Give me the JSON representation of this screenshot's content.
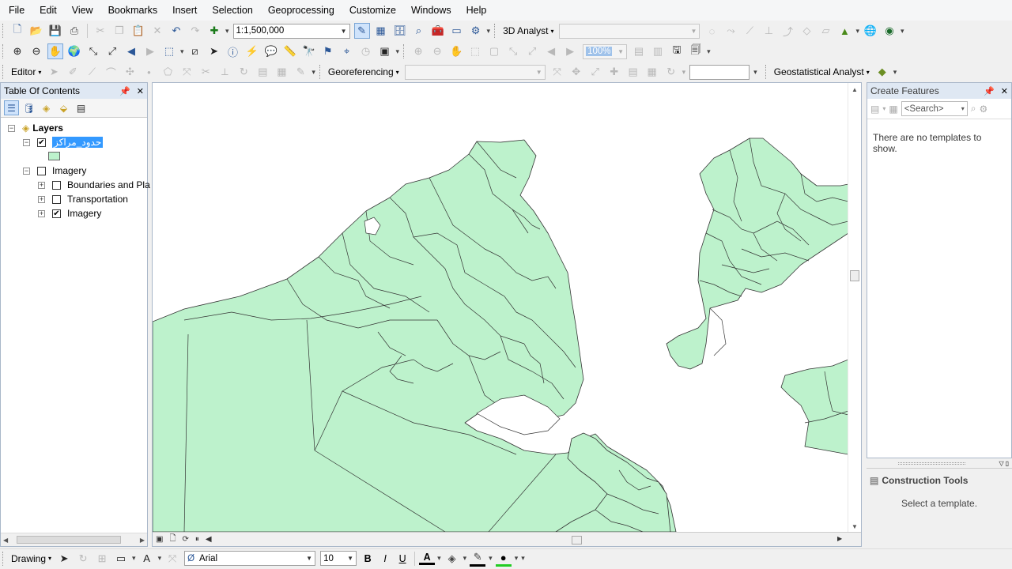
{
  "menu": [
    "File",
    "Edit",
    "View",
    "Bookmarks",
    "Insert",
    "Selection",
    "Geoprocessing",
    "Customize",
    "Windows",
    "Help"
  ],
  "toolbar": {
    "scale": "1:1,500,000",
    "analyst_3d": "3D Analyst",
    "zoom_percent": "100%",
    "editor": "Editor",
    "georeferencing": "Georeferencing",
    "geostatistical": "Geostatistical Analyst"
  },
  "toc": {
    "title": "Table Of Contents",
    "layers_root": "Layers",
    "items": [
      {
        "label": "حدود_مراكز",
        "checked": true,
        "selected": true
      },
      {
        "label": "Imagery",
        "checked": false
      },
      {
        "label": "Boundaries and Pla",
        "checked": false
      },
      {
        "label": "Transportation",
        "checked": false
      },
      {
        "label": "Imagery",
        "checked": true
      }
    ],
    "expand_minus": "−",
    "expand_plus": "+",
    "check_mark": "✔"
  },
  "create_features": {
    "title": "Create Features",
    "search_placeholder": "<Search>",
    "message": "There are no templates to show."
  },
  "construction_tools": {
    "title": "Construction Tools",
    "message": "Select a template."
  },
  "drawing": {
    "label": "Drawing",
    "font": "Arial",
    "size": "10",
    "bold": "B",
    "italic": "I",
    "underline": "U",
    "text_tool": "A"
  },
  "colors": {
    "polygon_fill": "#bdf2cc",
    "selection": "#3399ff"
  }
}
